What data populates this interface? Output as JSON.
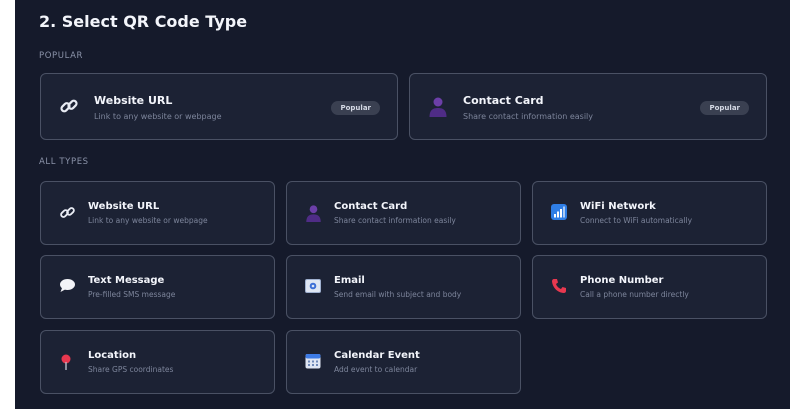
{
  "section": {
    "title": "2. Select QR Code Type",
    "popular_label": "POPULAR",
    "all_label": "ALL TYPES"
  },
  "popular": [
    {
      "name": "Website URL",
      "desc": "Link to any website or webpage",
      "badge": "Popular",
      "icon": "link-icon"
    },
    {
      "name": "Contact Card",
      "desc": "Share contact information easily",
      "badge": "Popular",
      "icon": "person-icon"
    }
  ],
  "types": [
    {
      "name": "Website URL",
      "desc": "Link to any website or webpage",
      "icon": "link-icon"
    },
    {
      "name": "Contact Card",
      "desc": "Share contact information easily",
      "icon": "person-icon"
    },
    {
      "name": "WiFi Network",
      "desc": "Connect to WiFi automatically",
      "icon": "signal-icon"
    },
    {
      "name": "Text Message",
      "desc": "Pre-filled SMS message",
      "icon": "speech-bubble-icon"
    },
    {
      "name": "Email",
      "desc": "Send email with subject and body",
      "icon": "email-icon"
    },
    {
      "name": "Phone Number",
      "desc": "Call a phone number directly",
      "icon": "phone-icon"
    },
    {
      "name": "Location",
      "desc": "Share GPS coordinates",
      "icon": "pin-icon"
    },
    {
      "name": "Calendar Event",
      "desc": "Add event to calendar",
      "icon": "calendar-icon"
    }
  ],
  "colors": {
    "background": "#151a2b",
    "card": "#1c2234",
    "card_border": "#4a5164",
    "badge": "#3a4051"
  }
}
